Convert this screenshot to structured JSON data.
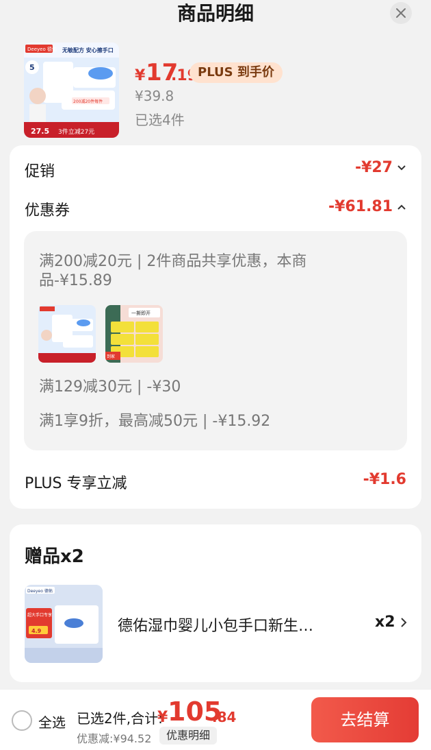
{
  "header": {
    "title": "商品明细"
  },
  "product": {
    "price_yen": "¥",
    "price_int": "17",
    "price_dec": ".19",
    "plus_badge": "PLUS 到手价",
    "original_price": "¥39.8",
    "selected_count": "已选4件",
    "image_text": {
      "brand": "Deeyeo 德佑",
      "tag": "618",
      "slogan": "无敏配方 安心擦手口",
      "days": "5",
      "promo": "200减20件每件",
      "bottom_price": "27.5",
      "bottom_promo": "3件立减27元"
    }
  },
  "promotions": {
    "promo_label": "促销",
    "promo_value": "-¥27",
    "coupon_label": "优惠券",
    "coupon_value": "-¥61.81",
    "coupon_line1": "满200减20元 | 2件商品共享优惠，本商",
    "coupon_line2": "品-¥15.89",
    "coupon_thumb2_text": "一撕即开",
    "coupon_thumb2_tag": "到家",
    "coupon_line3": "满129减30元 | -¥30",
    "coupon_line4": "满1享9折，最高减50元 | -¥15.92",
    "plus_label": "PLUS 专享立减",
    "plus_value": "-¥1.6"
  },
  "gifts": {
    "title": "赠品x2",
    "item_name": "德佑湿巾婴儿小包手口新生…",
    "item_qty": "x2",
    "image_text": {
      "brand": "Deeyeo 德佑",
      "price": "4.9",
      "badge": "超大手口专享"
    }
  },
  "footer": {
    "select_all": "全选",
    "summary": "已选2件,合计:",
    "total_yen": "¥",
    "total_int": "105",
    "total_dec": ".84",
    "discount": "优惠减:¥94.52",
    "detail_button": "优惠明细",
    "checkout_button": "去结算"
  },
  "colors": {
    "accent": "#e23a2f",
    "checkout": "#e8453c",
    "plus_badge_bg": "#ffe2cf"
  }
}
